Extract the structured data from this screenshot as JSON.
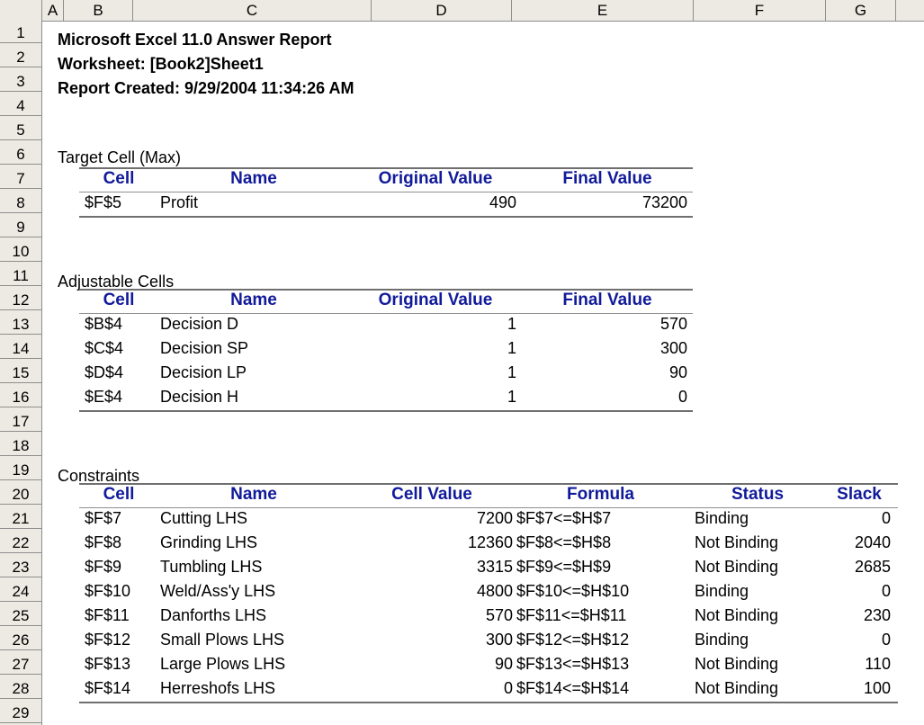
{
  "columns": [
    "A",
    "B",
    "C",
    "D",
    "E",
    "F",
    "G"
  ],
  "rows": [
    "1",
    "2",
    "3",
    "4",
    "5",
    "6",
    "7",
    "8",
    "9",
    "10",
    "11",
    "12",
    "13",
    "14",
    "15",
    "16",
    "17",
    "18",
    "19",
    "20",
    "21",
    "22",
    "23",
    "24",
    "25",
    "26",
    "27",
    "28",
    "29"
  ],
  "report": {
    "title": "Microsoft Excel 11.0 Answer Report",
    "worksheet": "Worksheet: [Book2]Sheet1",
    "created": "Report Created: 9/29/2004 11:34:26 AM"
  },
  "target": {
    "section_label": "Target Cell (Max)",
    "headers": {
      "cell": "Cell",
      "name": "Name",
      "original": "Original Value",
      "final": "Final Value"
    },
    "rows": [
      {
        "cell": "$F$5",
        "name": "Profit",
        "original": "490",
        "final": "73200"
      }
    ]
  },
  "adjustable": {
    "section_label": "Adjustable Cells",
    "headers": {
      "cell": "Cell",
      "name": "Name",
      "original": "Original Value",
      "final": "Final Value"
    },
    "rows": [
      {
        "cell": "$B$4",
        "name": "Decision D",
        "original": "1",
        "final": "570"
      },
      {
        "cell": "$C$4",
        "name": "Decision SP",
        "original": "1",
        "final": "300"
      },
      {
        "cell": "$D$4",
        "name": "Decision LP",
        "original": "1",
        "final": "90"
      },
      {
        "cell": "$E$4",
        "name": "Decision H",
        "original": "1",
        "final": "0"
      }
    ]
  },
  "constraints": {
    "section_label": "Constraints",
    "headers": {
      "cell": "Cell",
      "name": "Name",
      "value": "Cell Value",
      "formula": "Formula",
      "status": "Status",
      "slack": "Slack"
    },
    "rows": [
      {
        "cell": "$F$7",
        "name": "Cutting LHS",
        "value": "7200",
        "formula": "$F$7<=$H$7",
        "status": "Binding",
        "slack": "0"
      },
      {
        "cell": "$F$8",
        "name": "Grinding LHS",
        "value": "12360",
        "formula": "$F$8<=$H$8",
        "status": "Not Binding",
        "slack": "2040"
      },
      {
        "cell": "$F$9",
        "name": "Tumbling LHS",
        "value": "3315",
        "formula": "$F$9<=$H$9",
        "status": "Not Binding",
        "slack": "2685"
      },
      {
        "cell": "$F$10",
        "name": "Weld/Ass'y LHS",
        "value": "4800",
        "formula": "$F$10<=$H$10",
        "status": "Binding",
        "slack": "0"
      },
      {
        "cell": "$F$11",
        "name": "Danforths LHS",
        "value": "570",
        "formula": "$F$11<=$H$11",
        "status": "Not Binding",
        "slack": "230"
      },
      {
        "cell": "$F$12",
        "name": "Small Plows LHS",
        "value": "300",
        "formula": "$F$12<=$H$12",
        "status": "Binding",
        "slack": "0"
      },
      {
        "cell": "$F$13",
        "name": "Large Plows LHS",
        "value": "90",
        "formula": "$F$13<=$H$13",
        "status": "Not Binding",
        "slack": "110"
      },
      {
        "cell": "$F$14",
        "name": "Herreshofs LHS",
        "value": "0",
        "formula": "$F$14<=$H$14",
        "status": "Not Binding",
        "slack": "100"
      }
    ]
  }
}
